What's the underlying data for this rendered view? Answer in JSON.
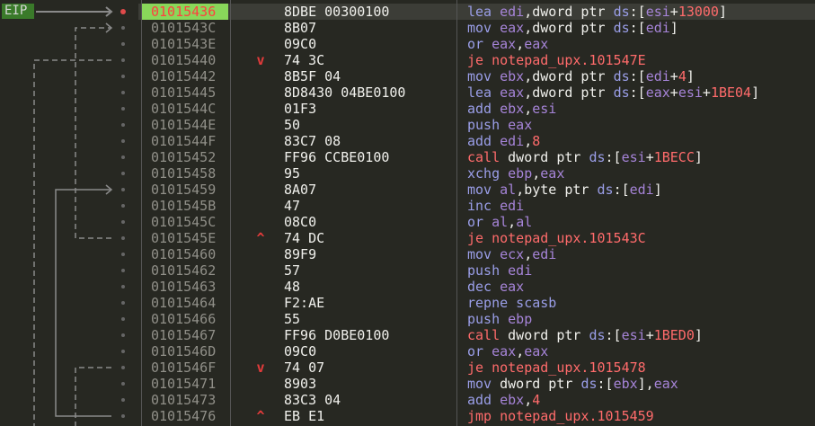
{
  "eip_label": "EIP",
  "colors": {
    "background": "#272822",
    "eip_highlight": "#89d75a",
    "breakpoint": "#e04a4a",
    "address": "#908f88",
    "mnemonic": "#9a9ee8",
    "jump_mnemonic": "#ff6b6b",
    "register": "#a684d8",
    "number": "#ff6b6b",
    "jump_arrow": "#e23b3b"
  },
  "rows": [
    {
      "address": "01015436",
      "bytes": "8DBE 00300100",
      "arrow": "",
      "current": true,
      "breakpoint": true,
      "tokens": [
        {
          "t": "mn",
          "v": "lea"
        },
        {
          "t": "sp",
          "v": " "
        },
        {
          "t": "reg",
          "v": "edi"
        },
        {
          "t": "txt",
          "v": ","
        },
        {
          "t": "kw",
          "v": "dword ptr"
        },
        {
          "t": "sp",
          "v": " "
        },
        {
          "t": "seg",
          "v": "ds"
        },
        {
          "t": "txt",
          "v": ":["
        },
        {
          "t": "reg",
          "v": "esi"
        },
        {
          "t": "txt",
          "v": "+"
        },
        {
          "t": "num",
          "v": "13000"
        },
        {
          "t": "txt",
          "v": "]"
        }
      ]
    },
    {
      "address": "0101543C",
      "bytes": "8B07",
      "arrow": "",
      "tokens": [
        {
          "t": "mn",
          "v": "mov"
        },
        {
          "t": "sp",
          "v": " "
        },
        {
          "t": "reg",
          "v": "eax"
        },
        {
          "t": "txt",
          "v": ","
        },
        {
          "t": "kw",
          "v": "dword ptr"
        },
        {
          "t": "sp",
          "v": " "
        },
        {
          "t": "seg",
          "v": "ds"
        },
        {
          "t": "txt",
          "v": ":["
        },
        {
          "t": "reg",
          "v": "edi"
        },
        {
          "t": "txt",
          "v": "]"
        }
      ]
    },
    {
      "address": "0101543E",
      "bytes": "09C0",
      "arrow": "",
      "tokens": [
        {
          "t": "mn",
          "v": "or"
        },
        {
          "t": "sp",
          "v": " "
        },
        {
          "t": "reg",
          "v": "eax"
        },
        {
          "t": "txt",
          "v": ","
        },
        {
          "t": "reg",
          "v": "eax"
        }
      ]
    },
    {
      "address": "01015440",
      "bytes": "74 3C",
      "arrow": "down",
      "tokens": [
        {
          "t": "ctl",
          "v": "je notepad_upx.101547E"
        }
      ]
    },
    {
      "address": "01015442",
      "bytes": "8B5F 04",
      "arrow": "",
      "tokens": [
        {
          "t": "mn",
          "v": "mov"
        },
        {
          "t": "sp",
          "v": " "
        },
        {
          "t": "reg",
          "v": "ebx"
        },
        {
          "t": "txt",
          "v": ","
        },
        {
          "t": "kw",
          "v": "dword ptr"
        },
        {
          "t": "sp",
          "v": " "
        },
        {
          "t": "seg",
          "v": "ds"
        },
        {
          "t": "txt",
          "v": ":["
        },
        {
          "t": "reg",
          "v": "edi"
        },
        {
          "t": "txt",
          "v": "+"
        },
        {
          "t": "num",
          "v": "4"
        },
        {
          "t": "txt",
          "v": "]"
        }
      ]
    },
    {
      "address": "01015445",
      "bytes": "8D8430 04BE0100",
      "arrow": "",
      "tokens": [
        {
          "t": "mn",
          "v": "lea"
        },
        {
          "t": "sp",
          "v": " "
        },
        {
          "t": "reg",
          "v": "eax"
        },
        {
          "t": "txt",
          "v": ","
        },
        {
          "t": "kw",
          "v": "dword ptr"
        },
        {
          "t": "sp",
          "v": " "
        },
        {
          "t": "seg",
          "v": "ds"
        },
        {
          "t": "txt",
          "v": ":["
        },
        {
          "t": "reg",
          "v": "eax"
        },
        {
          "t": "txt",
          "v": "+"
        },
        {
          "t": "reg",
          "v": "esi"
        },
        {
          "t": "txt",
          "v": "+"
        },
        {
          "t": "num",
          "v": "1BE04"
        },
        {
          "t": "txt",
          "v": "]"
        }
      ]
    },
    {
      "address": "0101544C",
      "bytes": "01F3",
      "arrow": "",
      "tokens": [
        {
          "t": "mn",
          "v": "add"
        },
        {
          "t": "sp",
          "v": " "
        },
        {
          "t": "reg",
          "v": "ebx"
        },
        {
          "t": "txt",
          "v": ","
        },
        {
          "t": "reg",
          "v": "esi"
        }
      ]
    },
    {
      "address": "0101544E",
      "bytes": "50",
      "arrow": "",
      "tokens": [
        {
          "t": "mn",
          "v": "push"
        },
        {
          "t": "sp",
          "v": " "
        },
        {
          "t": "reg",
          "v": "eax"
        }
      ]
    },
    {
      "address": "0101544F",
      "bytes": "83C7 08",
      "arrow": "",
      "tokens": [
        {
          "t": "mn",
          "v": "add"
        },
        {
          "t": "sp",
          "v": " "
        },
        {
          "t": "reg",
          "v": "edi"
        },
        {
          "t": "txt",
          "v": ","
        },
        {
          "t": "num",
          "v": "8"
        }
      ]
    },
    {
      "address": "01015452",
      "bytes": "FF96 CCBE0100",
      "arrow": "",
      "tokens": [
        {
          "t": "ctl",
          "v": "call"
        },
        {
          "t": "sp",
          "v": " "
        },
        {
          "t": "kw",
          "v": "dword ptr"
        },
        {
          "t": "sp",
          "v": " "
        },
        {
          "t": "seg",
          "v": "ds"
        },
        {
          "t": "txt",
          "v": ":["
        },
        {
          "t": "reg",
          "v": "esi"
        },
        {
          "t": "txt",
          "v": "+"
        },
        {
          "t": "num",
          "v": "1BECC"
        },
        {
          "t": "txt",
          "v": "]"
        }
      ]
    },
    {
      "address": "01015458",
      "bytes": "95",
      "arrow": "",
      "tokens": [
        {
          "t": "mn",
          "v": "xchg"
        },
        {
          "t": "sp",
          "v": " "
        },
        {
          "t": "reg",
          "v": "ebp"
        },
        {
          "t": "txt",
          "v": ","
        },
        {
          "t": "reg",
          "v": "eax"
        }
      ]
    },
    {
      "address": "01015459",
      "bytes": "8A07",
      "arrow": "",
      "tokens": [
        {
          "t": "mn",
          "v": "mov"
        },
        {
          "t": "sp",
          "v": " "
        },
        {
          "t": "reg",
          "v": "al"
        },
        {
          "t": "txt",
          "v": ","
        },
        {
          "t": "kw",
          "v": "byte ptr"
        },
        {
          "t": "sp",
          "v": " "
        },
        {
          "t": "seg",
          "v": "ds"
        },
        {
          "t": "txt",
          "v": ":["
        },
        {
          "t": "reg",
          "v": "edi"
        },
        {
          "t": "txt",
          "v": "]"
        }
      ]
    },
    {
      "address": "0101545B",
      "bytes": "47",
      "arrow": "",
      "tokens": [
        {
          "t": "mn",
          "v": "inc"
        },
        {
          "t": "sp",
          "v": " "
        },
        {
          "t": "reg",
          "v": "edi"
        }
      ]
    },
    {
      "address": "0101545C",
      "bytes": "08C0",
      "arrow": "",
      "tokens": [
        {
          "t": "mn",
          "v": "or"
        },
        {
          "t": "sp",
          "v": " "
        },
        {
          "t": "reg",
          "v": "al"
        },
        {
          "t": "txt",
          "v": ","
        },
        {
          "t": "reg",
          "v": "al"
        }
      ]
    },
    {
      "address": "0101545E",
      "bytes": "74 DC",
      "arrow": "up",
      "tokens": [
        {
          "t": "ctl",
          "v": "je notepad_upx.101543C"
        }
      ]
    },
    {
      "address": "01015460",
      "bytes": "89F9",
      "arrow": "",
      "tokens": [
        {
          "t": "mn",
          "v": "mov"
        },
        {
          "t": "sp",
          "v": " "
        },
        {
          "t": "reg",
          "v": "ecx"
        },
        {
          "t": "txt",
          "v": ","
        },
        {
          "t": "reg",
          "v": "edi"
        }
      ]
    },
    {
      "address": "01015462",
      "bytes": "57",
      "arrow": "",
      "tokens": [
        {
          "t": "mn",
          "v": "push"
        },
        {
          "t": "sp",
          "v": " "
        },
        {
          "t": "reg",
          "v": "edi"
        }
      ]
    },
    {
      "address": "01015463",
      "bytes": "48",
      "arrow": "",
      "tokens": [
        {
          "t": "mn",
          "v": "dec"
        },
        {
          "t": "sp",
          "v": " "
        },
        {
          "t": "reg",
          "v": "eax"
        }
      ]
    },
    {
      "address": "01015464",
      "bytes": "F2:AE",
      "arrow": "",
      "tokens": [
        {
          "t": "mn",
          "v": "repne scasb"
        }
      ]
    },
    {
      "address": "01015466",
      "bytes": "55",
      "arrow": "",
      "tokens": [
        {
          "t": "mn",
          "v": "push"
        },
        {
          "t": "sp",
          "v": " "
        },
        {
          "t": "reg",
          "v": "ebp"
        }
      ]
    },
    {
      "address": "01015467",
      "bytes": "FF96 D0BE0100",
      "arrow": "",
      "tokens": [
        {
          "t": "ctl",
          "v": "call"
        },
        {
          "t": "sp",
          "v": " "
        },
        {
          "t": "kw",
          "v": "dword ptr"
        },
        {
          "t": "sp",
          "v": " "
        },
        {
          "t": "seg",
          "v": "ds"
        },
        {
          "t": "txt",
          "v": ":["
        },
        {
          "t": "reg",
          "v": "esi"
        },
        {
          "t": "txt",
          "v": "+"
        },
        {
          "t": "num",
          "v": "1BED0"
        },
        {
          "t": "txt",
          "v": "]"
        }
      ]
    },
    {
      "address": "0101546D",
      "bytes": "09C0",
      "arrow": "",
      "tokens": [
        {
          "t": "mn",
          "v": "or"
        },
        {
          "t": "sp",
          "v": " "
        },
        {
          "t": "reg",
          "v": "eax"
        },
        {
          "t": "txt",
          "v": ","
        },
        {
          "t": "reg",
          "v": "eax"
        }
      ]
    },
    {
      "address": "0101546F",
      "bytes": "74 07",
      "arrow": "down",
      "tokens": [
        {
          "t": "ctl",
          "v": "je notepad_upx.1015478"
        }
      ]
    },
    {
      "address": "01015471",
      "bytes": "8903",
      "arrow": "",
      "tokens": [
        {
          "t": "mn",
          "v": "mov"
        },
        {
          "t": "sp",
          "v": " "
        },
        {
          "t": "kw",
          "v": "dword ptr"
        },
        {
          "t": "sp",
          "v": " "
        },
        {
          "t": "seg",
          "v": "ds"
        },
        {
          "t": "txt",
          "v": ":["
        },
        {
          "t": "reg",
          "v": "ebx"
        },
        {
          "t": "txt",
          "v": "],"
        },
        {
          "t": "reg",
          "v": "eax"
        }
      ]
    },
    {
      "address": "01015473",
      "bytes": "83C3 04",
      "arrow": "",
      "tokens": [
        {
          "t": "mn",
          "v": "add"
        },
        {
          "t": "sp",
          "v": " "
        },
        {
          "t": "reg",
          "v": "ebx"
        },
        {
          "t": "txt",
          "v": ","
        },
        {
          "t": "num",
          "v": "4"
        }
      ]
    },
    {
      "address": "01015476",
      "bytes": "EB E1",
      "arrow": "up",
      "tokens": [
        {
          "t": "ctl",
          "v": "jmp notepad_upx.1015459"
        }
      ]
    }
  ]
}
